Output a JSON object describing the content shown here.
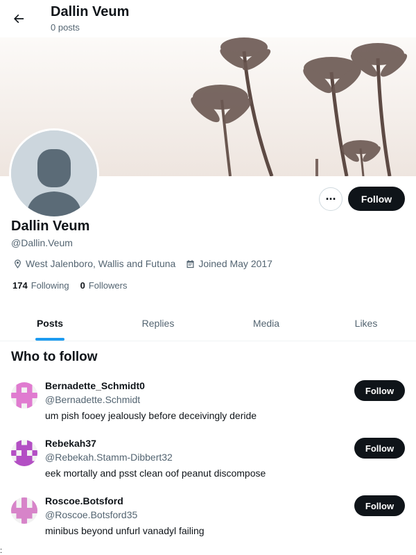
{
  "header": {
    "name": "Dallin Veum",
    "post_count": "0 posts",
    "back_icon": "arrow-left-icon"
  },
  "profile": {
    "name": "Dallin Veum",
    "handle": "@Dallin.Veum",
    "location": "West Jalenboro, Wallis and Futuna",
    "joined": "Joined May 2017",
    "following_count": "174",
    "following_label": "Following",
    "followers_count": "0",
    "followers_label": "Followers",
    "more_label": "···",
    "follow_label": "Follow"
  },
  "tabs": [
    {
      "label": "Posts",
      "active": true
    },
    {
      "label": "Replies",
      "active": false
    },
    {
      "label": "Media",
      "active": false
    },
    {
      "label": "Likes",
      "active": false
    }
  ],
  "who_to_follow": {
    "title": "Who to follow",
    "items": [
      {
        "name": "Bernadette_Schmidt0",
        "handle": "@Bernadette.Schmidt",
        "bio": "um pish fooey jealously before deceivingly deride",
        "follow_label": "Follow",
        "avatar_color": "#e07bd0"
      },
      {
        "name": "Rebekah37",
        "handle": "@Rebekah.Stamm-Dibbert32",
        "bio": "eek mortally and psst clean oof peanut discompose",
        "follow_label": "Follow",
        "avatar_color": "#b34fc4"
      },
      {
        "name": "Roscoe.Botsford",
        "handle": "@Roscoe.Botsford35",
        "bio": "minibus beyond unfurl vanadyl failing",
        "follow_label": "Follow",
        "avatar_color": "#d784c9"
      }
    ]
  },
  "colors": {
    "accent": "#1d9bf0",
    "button_dark": "#0f1419",
    "secondary_text": "#536471"
  },
  "stray_mark": ":"
}
